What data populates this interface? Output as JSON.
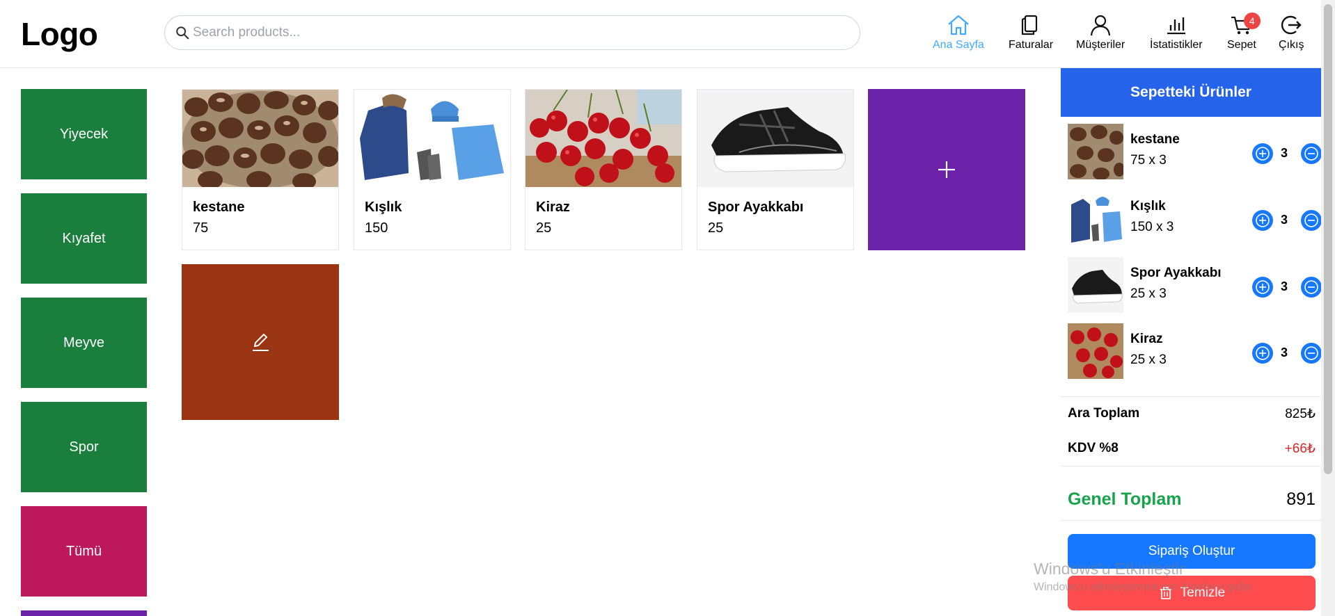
{
  "header": {
    "logo": "Logo",
    "search_placeholder": "Search products...",
    "nav": [
      {
        "label": "Ana Sayfa",
        "icon": "home-icon",
        "active": true
      },
      {
        "label": "Faturalar",
        "icon": "invoice-icon"
      },
      {
        "label": "Müşteriler",
        "icon": "user-icon"
      },
      {
        "label": "İstatistikler",
        "icon": "chart-icon"
      },
      {
        "label": "Sepet",
        "icon": "cart-icon",
        "badge": "4"
      },
      {
        "label": "Çıkış",
        "icon": "logout-icon"
      }
    ]
  },
  "categories": [
    {
      "label": "Yiyecek",
      "color": "#1a7f3c"
    },
    {
      "label": "Kıyafet",
      "color": "#1a7f3c"
    },
    {
      "label": "Meyve",
      "color": "#1a7f3c"
    },
    {
      "label": "Spor",
      "color": "#1a7f3c"
    },
    {
      "label": "Tümü",
      "color": "#be185d"
    }
  ],
  "products": [
    {
      "name": "kestane",
      "price": "75"
    },
    {
      "name": "Kışlık",
      "price": "150"
    },
    {
      "name": "Kiraz",
      "price": "25"
    },
    {
      "name": "Spor Ayakkabı",
      "price": "25"
    }
  ],
  "tiles": {
    "add_color": "#6b21a8",
    "edit_color": "#9a3412",
    "add_icon": "plus-icon",
    "edit_icon": "edit-icon"
  },
  "cart": {
    "title": "Sepetteki Ürünler",
    "items": [
      {
        "name": "kestane",
        "line": "75 x 3",
        "qty": "3"
      },
      {
        "name": "Kışlık",
        "line": "150 x 3",
        "qty": "3"
      },
      {
        "name": "Spor Ayakkabı",
        "line": "25 x 3",
        "qty": "3"
      },
      {
        "name": "Kiraz",
        "line": "25 x 3",
        "qty": "3"
      }
    ],
    "subtotal_label": "Ara Toplam",
    "subtotal_value": "825₺",
    "tax_label": "KDV %8",
    "tax_value": "+66₺",
    "total_label": "Genel Toplam",
    "total_value": "891",
    "order_button": "Sipariş Oluştur",
    "clear_button": "Temizle"
  },
  "watermark": {
    "line1": "Windows'u Etkinleştir",
    "line2": "Windows'u etkinleştirmek için Ayarlar'a gidin."
  },
  "colors": {
    "accent": "#2563eb",
    "button": "#1677ff",
    "danger": "#ff4d4f",
    "total_green": "#16a34a",
    "tax_red": "#dc2626"
  }
}
